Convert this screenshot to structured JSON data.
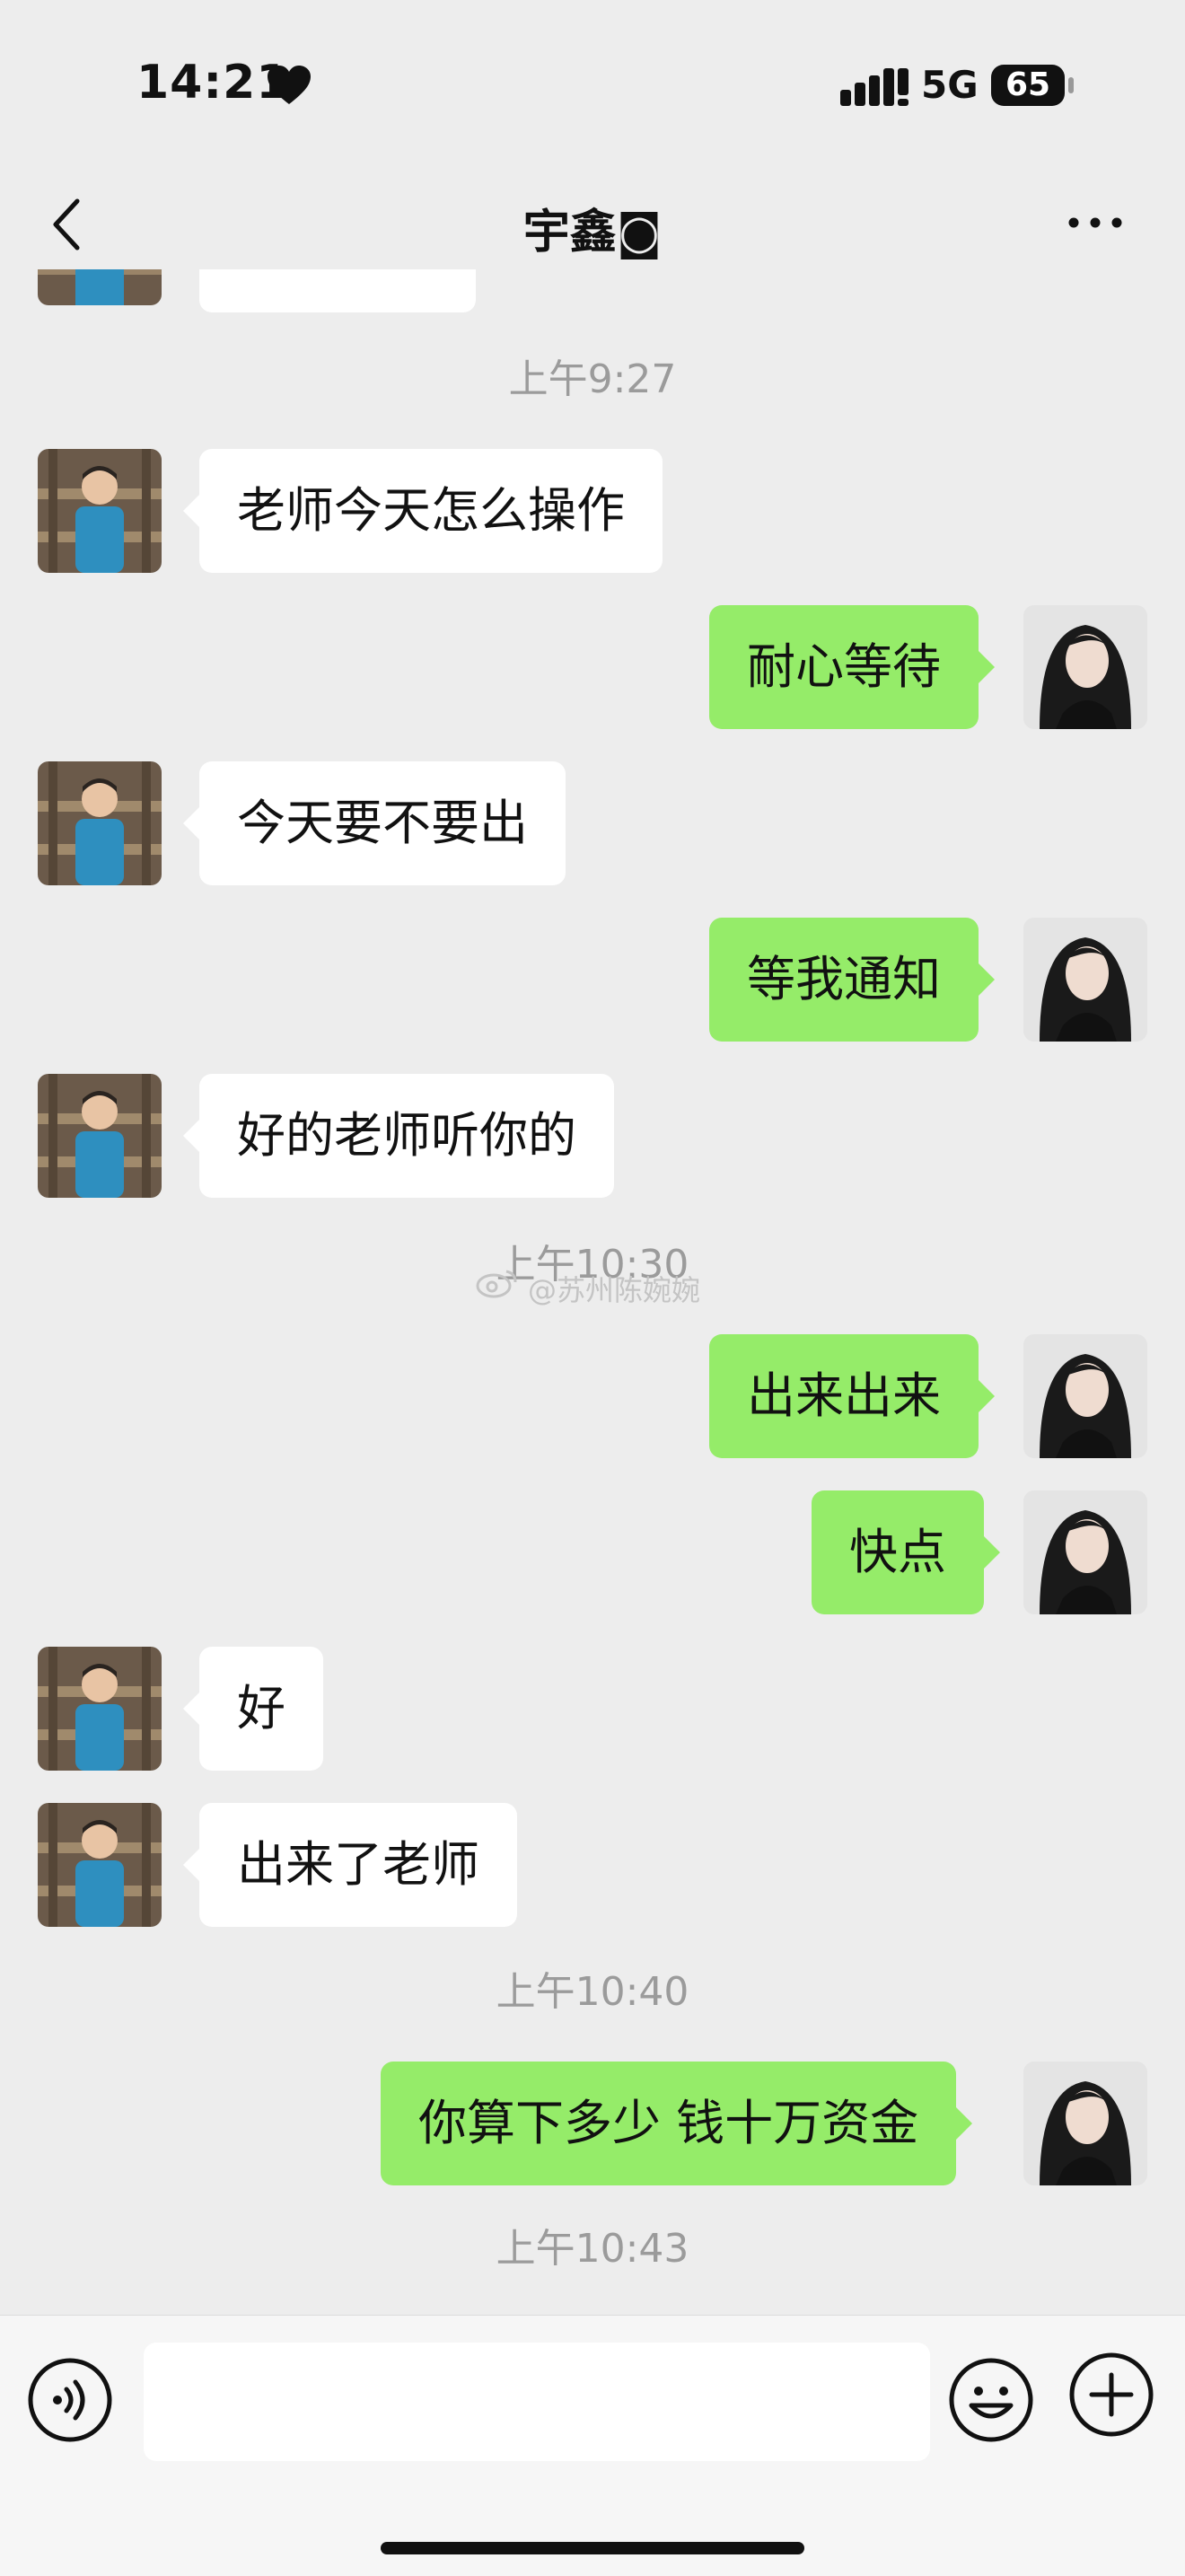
{
  "status_bar": {
    "time": "14:21",
    "network": "5G",
    "battery": "65",
    "icons": [
      "heart-icon",
      "signal-icon",
      "battery-icon"
    ]
  },
  "nav": {
    "title": "宇鑫",
    "title_symbol": "◙",
    "icons": [
      "back-chevron-icon",
      "more-dots-icon"
    ]
  },
  "timestamps": [
    "上午9:27",
    "上午10:30",
    "上午10:40",
    "上午10:43"
  ],
  "messages": [
    {
      "side": "in",
      "text": "老师今天怎么操作"
    },
    {
      "side": "out",
      "text": "耐心等待"
    },
    {
      "side": "in",
      "text": "今天要不要出"
    },
    {
      "side": "out",
      "text": "等我通知"
    },
    {
      "side": "in",
      "text": "好的老师听你的"
    },
    {
      "side": "out",
      "text": "出来出来"
    },
    {
      "side": "out",
      "text": "快点"
    },
    {
      "side": "in",
      "text": "好"
    },
    {
      "side": "in",
      "text": "出来了老师"
    },
    {
      "side": "out",
      "text": "你算下多少  钱十万资金"
    }
  ],
  "watermark": "@苏州陈婉婉",
  "input_bar": {
    "placeholder": "",
    "icons": [
      "voice-icon",
      "emoji-icon",
      "plus-icon"
    ]
  },
  "colors": {
    "background": "#ededed",
    "outgoing_bubble": "#95ec69",
    "incoming_bubble": "#ffffff",
    "timestamp": "#9b9b9b"
  }
}
